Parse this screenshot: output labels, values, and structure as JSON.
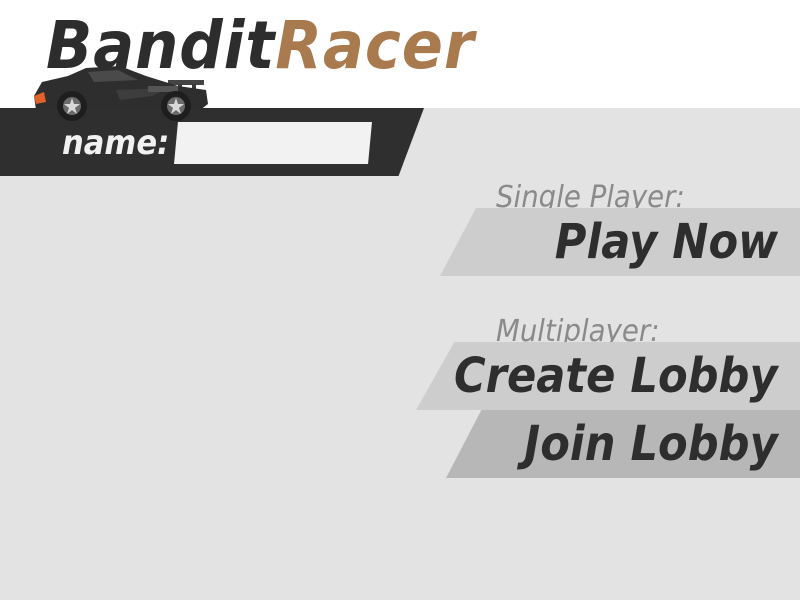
{
  "title": {
    "part1": "Bandit",
    "part2": "Racer"
  },
  "colors": {
    "background": "#e3e3e3",
    "header_bg": "#ffffff",
    "title_dark": "#2d2d2d",
    "title_accent": "#a87a4e",
    "name_bar": "#2f2f2f",
    "button_light": "#cdcdcd",
    "button_dark": "#b7b7b7"
  },
  "name_field": {
    "label": "name:",
    "value": "",
    "placeholder": ""
  },
  "single_player": {
    "section_label": "Single Player:",
    "play_label": "Play Now"
  },
  "multiplayer": {
    "section_label": "Multiplayer:",
    "create_label": "Create Lobby",
    "join_label": "Join Lobby"
  },
  "icons": {
    "logo_car": "race-car-icon"
  }
}
